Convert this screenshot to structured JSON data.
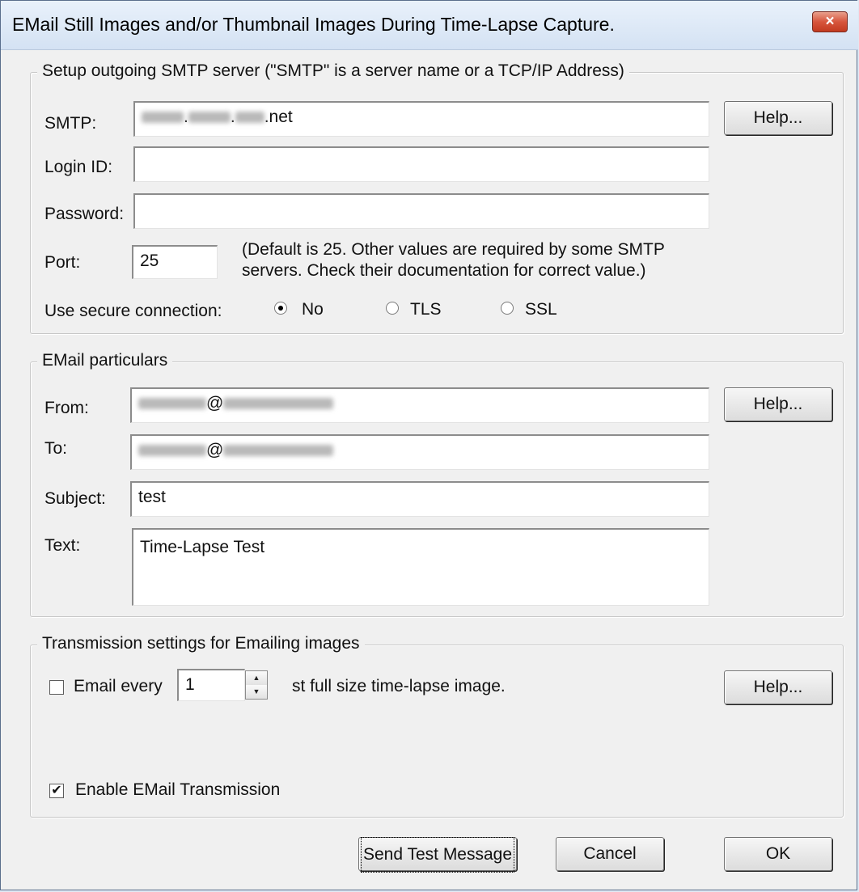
{
  "window": {
    "title": "EMail Still Images and/or Thumbnail Images During Time-Lapse Capture.",
    "close_glyph": "×"
  },
  "smtp_group": {
    "title": "Setup outgoing SMTP server (\"SMTP\" is a server name or a TCP/IP Address)",
    "smtp_label": "SMTP:",
    "smtp_dots_1": ".",
    "smtp_dots_2": ".",
    "smtp_suffix": ".net",
    "login_label": "Login ID:",
    "login_value": "",
    "password_label": "Password:",
    "password_value": "",
    "port_label": "Port:",
    "port_value": "25",
    "port_note_line1": "(Default is 25.  Other values are required by some SMTP",
    "port_note_line2": "servers.  Check their documentation for correct value.)",
    "secure_label": "Use secure connection:",
    "secure_options": [
      "No",
      "TLS",
      "SSL"
    ],
    "secure_selected": "No",
    "help_label": "Help..."
  },
  "email_group": {
    "title": "EMail particulars",
    "from_label": "From:",
    "from_at": "@",
    "to_label": "To:",
    "to_at": "@",
    "subject_label": "Subject:",
    "subject_value": "test",
    "text_label": "Text:",
    "text_value": "Time-Lapse Test",
    "help_label": "Help..."
  },
  "transmission_group": {
    "title": "Transmission settings for Emailing images",
    "email_every_label": "Email every",
    "email_every_checked": false,
    "interval_value": "1",
    "interval_suffix": "st  full size time-lapse image.",
    "enable_label": "Enable EMail Transmission",
    "enable_checked": true,
    "help_label": "Help..."
  },
  "footer": {
    "send_test_label": "Send Test Message",
    "cancel_label": "Cancel",
    "ok_label": "OK"
  },
  "icons": {
    "spin_up": "▲",
    "spin_down": "▼",
    "check_mark": "✔"
  }
}
